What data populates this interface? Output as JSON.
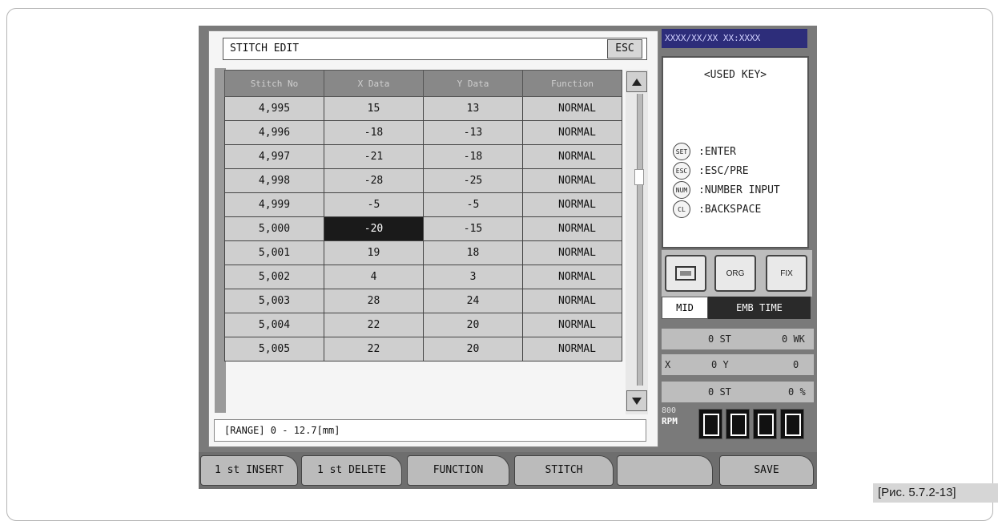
{
  "dialog": {
    "title": "STITCH EDIT",
    "esc_label": "ESC",
    "columns": [
      "Stitch No",
      "X Data",
      "Y Data",
      "Function"
    ],
    "rows": [
      {
        "no": "4,995",
        "x": "15",
        "y": "13",
        "fn": "NORMAL"
      },
      {
        "no": "4,996",
        "x": "-18",
        "y": "-13",
        "fn": "NORMAL"
      },
      {
        "no": "4,997",
        "x": "-21",
        "y": "-18",
        "fn": "NORMAL"
      },
      {
        "no": "4,998",
        "x": "-28",
        "y": "-25",
        "fn": "NORMAL"
      },
      {
        "no": "4,999",
        "x": "-5",
        "y": "-5",
        "fn": "NORMAL"
      },
      {
        "no": "5,000",
        "x": "-20",
        "y": "-15",
        "fn": "NORMAL"
      },
      {
        "no": "5,001",
        "x": "19",
        "y": "18",
        "fn": "NORMAL"
      },
      {
        "no": "5,002",
        "x": "4",
        "y": "3",
        "fn": "NORMAL"
      },
      {
        "no": "5,003",
        "x": "28",
        "y": "24",
        "fn": "NORMAL"
      },
      {
        "no": "5,004",
        "x": "22",
        "y": "20",
        "fn": "NORMAL"
      },
      {
        "no": "5,005",
        "x": "22",
        "y": "20",
        "fn": "NORMAL"
      }
    ],
    "selected_row": 5,
    "selected_col": "x",
    "range_text": "[RANGE] 0 - 12.7[mm]"
  },
  "right_panel": {
    "date_text": "XXXX/XX/XX XX:XXXX",
    "keys_title": "<USED KEY>",
    "keys": [
      {
        "key": "SET",
        "desc": ":ENTER"
      },
      {
        "key": "ESC",
        "desc": ":ESC/PRE"
      },
      {
        "key": "NUM",
        "desc": ":NUMBER INPUT"
      },
      {
        "key": "CL",
        "desc": ":BACKSPACE"
      }
    ],
    "icon_org": "ORG",
    "icon_fix": "FIX",
    "tab_mid": "MID",
    "tab_emb": "EMB TIME",
    "stat1": {
      "a": "0 ST",
      "b": "0 WK"
    },
    "stat2": {
      "lx": "X",
      "a": "0 Y",
      "b": "0"
    },
    "stat3": {
      "a": "0 ST",
      "b": "0 %"
    },
    "rpm_value": "800",
    "rpm_unit": "RPM"
  },
  "function_bar": [
    "1 st INSERT",
    "1 st DELETE",
    "FUNCTION",
    "STITCH",
    "",
    "SAVE"
  ],
  "caption": "[Рис. 5.7.2-13]",
  "colors": {
    "selected_cell": "#1a1a1a",
    "cell": "#cfcfcf",
    "header": "#888888"
  }
}
